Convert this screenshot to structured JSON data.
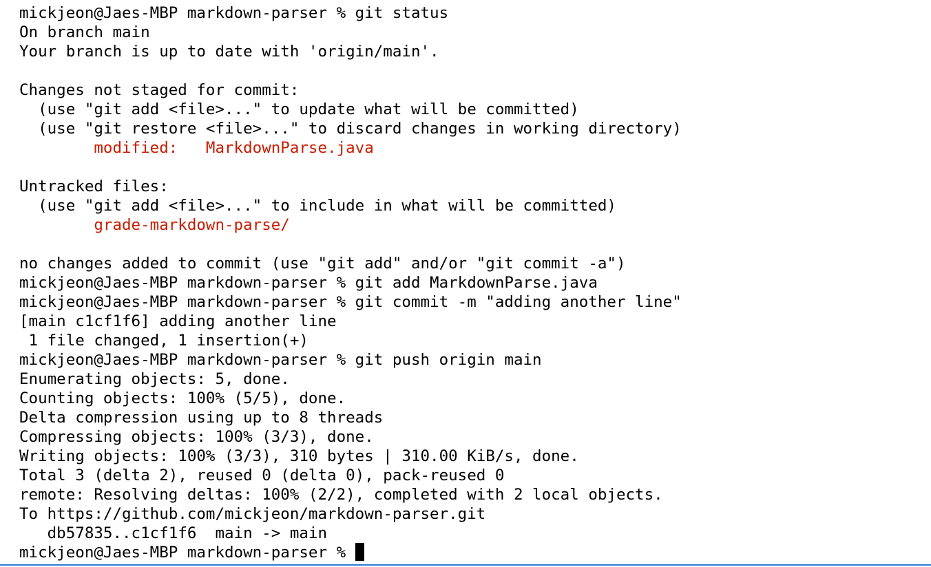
{
  "terminal": {
    "lines": [
      {
        "text": "mickjeon@Jaes-MBP markdown-parser % git status"
      },
      {
        "text": "On branch main"
      },
      {
        "text": "Your branch is up to date with 'origin/main'."
      },
      {
        "text": ""
      },
      {
        "text": "Changes not staged for commit:"
      },
      {
        "text": "  (use \"git add <file>...\" to update what will be committed)"
      },
      {
        "text": "  (use \"git restore <file>...\" to discard changes in working directory)"
      },
      {
        "text": "\tmodified:   MarkdownParse.java",
        "color": "red"
      },
      {
        "text": ""
      },
      {
        "text": "Untracked files:"
      },
      {
        "text": "  (use \"git add <file>...\" to include in what will be committed)"
      },
      {
        "text": "\tgrade-markdown-parse/",
        "color": "red"
      },
      {
        "text": ""
      },
      {
        "text": "no changes added to commit (use \"git add\" and/or \"git commit -a\")"
      },
      {
        "text": "mickjeon@Jaes-MBP markdown-parser % git add MarkdownParse.java"
      },
      {
        "text": "mickjeon@Jaes-MBP markdown-parser % git commit -m \"adding another line\""
      },
      {
        "text": "[main c1cf1f6] adding another line"
      },
      {
        "text": " 1 file changed, 1 insertion(+)"
      },
      {
        "text": "mickjeon@Jaes-MBP markdown-parser % git push origin main"
      },
      {
        "text": "Enumerating objects: 5, done."
      },
      {
        "text": "Counting objects: 100% (5/5), done."
      },
      {
        "text": "Delta compression using up to 8 threads"
      },
      {
        "text": "Compressing objects: 100% (3/3), done."
      },
      {
        "text": "Writing objects: 100% (3/3), 310 bytes | 310.00 KiB/s, done."
      },
      {
        "text": "Total 3 (delta 2), reused 0 (delta 0), pack-reused 0"
      },
      {
        "text": "remote: Resolving deltas: 100% (2/2), completed with 2 local objects."
      },
      {
        "text": "To https://github.com/mickjeon/markdown-parser.git"
      },
      {
        "text": "   db57835..c1cf1f6  main -> main"
      }
    ],
    "prompt": "mickjeon@Jaes-MBP markdown-parser % ",
    "colors": {
      "text": "#000000",
      "git_status_red": "#c91b00",
      "background": "#ffffff",
      "focus_border": "#2f7bd8"
    }
  }
}
